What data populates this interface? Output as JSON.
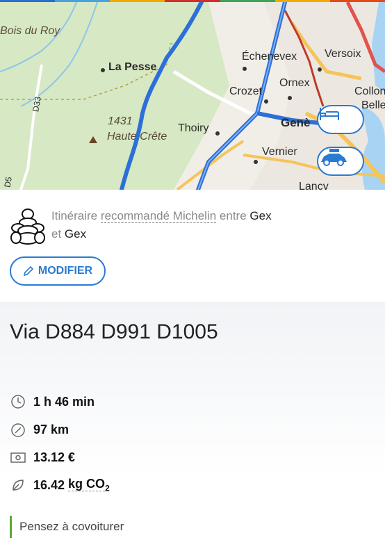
{
  "top_bar": {
    "colors": [
      "#2a6fc9",
      "#4aa3df",
      "#f2a900",
      "#d32f2f",
      "#3aa657",
      "#f2a900",
      "#e64a19"
    ]
  },
  "map": {
    "labels": {
      "bois_du_roy": "Bois du Roy",
      "la_pesse": "La Pesse",
      "alt": "1431",
      "haute_crete": "Haute Crête",
      "thoiry": "Thoiry",
      "echenevex": "Échenevex",
      "versoix": "Versoix",
      "crozet": "Crozet",
      "ornex": "Ornex",
      "collon": "Collon",
      "belle": "Belle",
      "geneve": "Genè",
      "vernier": "Vernier",
      "lancy": "Lancy",
      "d33": "D33",
      "d5": "D5"
    },
    "hotel_button": "bed-icon",
    "car_button": "car-icon"
  },
  "intro": {
    "prefix": "Itinéraire",
    "recommended": "recommandé Michelin",
    "between": "entre",
    "from": "Gex",
    "and": "et",
    "to": "Gex"
  },
  "modify_label": "MODIFIER",
  "route": {
    "title": "Via D884 D991 D1005",
    "duration": "1 h 46 min",
    "distance": "97 km",
    "cost": "13.12 €",
    "co2_value": "16.42",
    "co2_unit": "kg CO",
    "co2_sub": "2"
  },
  "tip": "Pensez à covoiturer"
}
